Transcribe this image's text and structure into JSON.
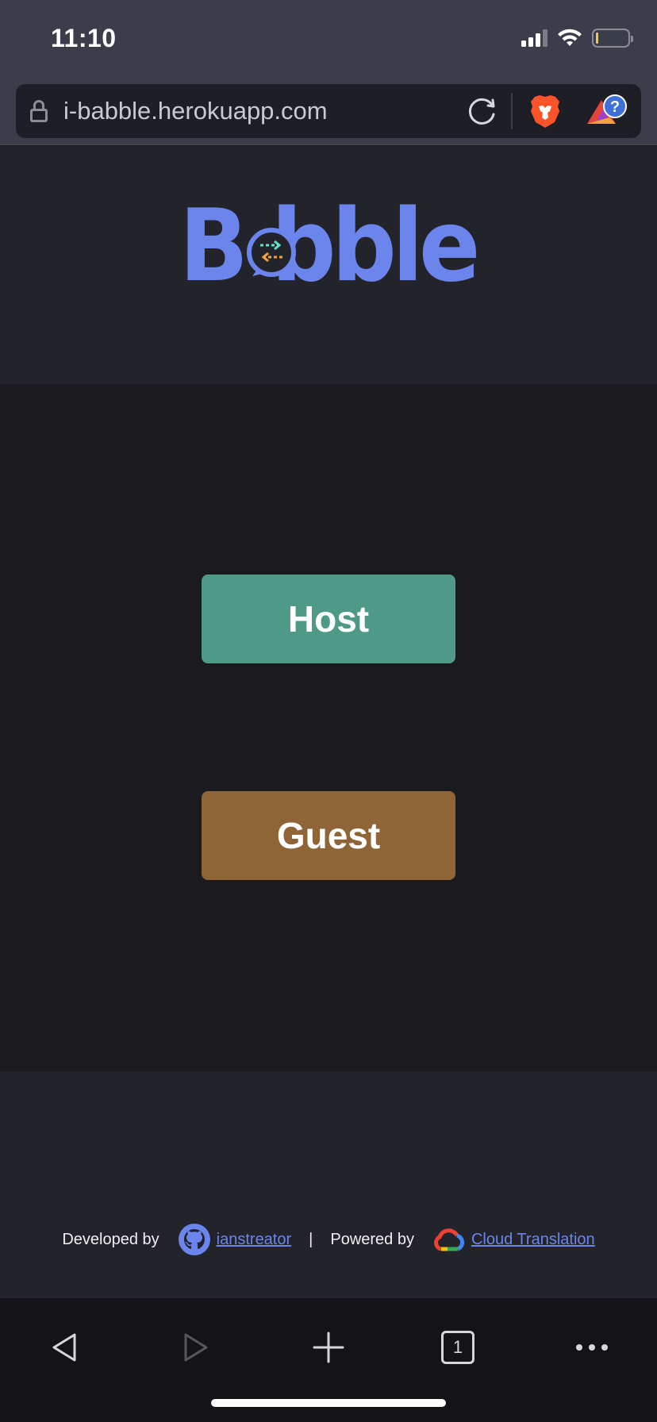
{
  "status_bar": {
    "time": "11:10"
  },
  "browser": {
    "url": "i-babble.herokuapp.com",
    "tab_count": "1"
  },
  "header": {
    "logo_text": "Babble"
  },
  "main": {
    "host_label": "Host",
    "guest_label": "Guest"
  },
  "footer": {
    "developed_by": "Developed by",
    "author": "ianstreator",
    "separator": "|",
    "powered_by": "Powered by",
    "service": "Cloud Translation"
  },
  "colors": {
    "accent": "#6b85ec",
    "host_button": "#4f9a86",
    "guest_button": "#8f6538"
  },
  "icons": [
    "lock-icon",
    "reload-icon",
    "brave-lion-icon",
    "brave-rewards-icon",
    "github-icon",
    "google-cloud-icon",
    "back-icon",
    "forward-icon",
    "new-tab-icon",
    "tabs-icon",
    "more-icon"
  ]
}
